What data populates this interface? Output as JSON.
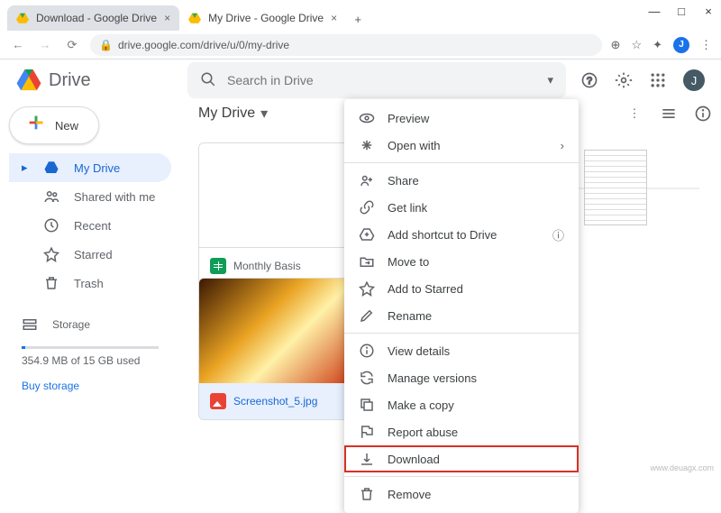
{
  "window": {
    "min": "—",
    "max": "□",
    "close": "×"
  },
  "tabs": [
    {
      "title": "Download - Google Drive",
      "active": false
    },
    {
      "title": "My Drive - Google Drive",
      "active": true
    }
  ],
  "addressbar": {
    "url": "drive.google.com/drive/u/0/my-drive",
    "avatar_letter": "J"
  },
  "header": {
    "product": "Drive",
    "search_placeholder": "Search in Drive",
    "avatar_letter": "J"
  },
  "sidebar": {
    "new_label": "New",
    "items": [
      {
        "label": "My Drive",
        "active": true
      },
      {
        "label": "Shared with me"
      },
      {
        "label": "Recent"
      },
      {
        "label": "Starred"
      },
      {
        "label": "Trash"
      }
    ],
    "storage_label": "Storage",
    "storage_text": "354.9 MB of 15 GB used",
    "buy_label": "Buy storage"
  },
  "main": {
    "heading": "My Drive",
    "files": [
      {
        "name": "Monthly Basis",
        "type": "sheets"
      },
      {
        "name": "Screenshot_5.jpg",
        "type": "image",
        "selected": true
      }
    ]
  },
  "context_menu": {
    "items": [
      {
        "label": "Preview",
        "icon": "eye"
      },
      {
        "label": "Open with",
        "icon": "open",
        "chevron": true
      },
      "sep",
      {
        "label": "Share",
        "icon": "share"
      },
      {
        "label": "Get link",
        "icon": "link"
      },
      {
        "label": "Add shortcut to Drive",
        "icon": "shortcut",
        "help": true
      },
      {
        "label": "Move to",
        "icon": "move"
      },
      {
        "label": "Add to Starred",
        "icon": "star"
      },
      {
        "label": "Rename",
        "icon": "rename"
      },
      "sep",
      {
        "label": "View details",
        "icon": "info"
      },
      {
        "label": "Manage versions",
        "icon": "versions"
      },
      {
        "label": "Make a copy",
        "icon": "copy"
      },
      {
        "label": "Report abuse",
        "icon": "report"
      },
      {
        "label": "Download",
        "icon": "download",
        "highlight": true
      },
      "sep",
      {
        "label": "Remove",
        "icon": "remove"
      }
    ]
  },
  "watermark": "www.deuagx.com",
  "colors": {
    "blue": "#1a73e8",
    "grey": "#5f6368",
    "red": "#d93025",
    "green": "#0f9d58"
  },
  "plus_colors": [
    "#ea4335",
    "#fbbc04",
    "#34a853",
    "#4285f4"
  ]
}
